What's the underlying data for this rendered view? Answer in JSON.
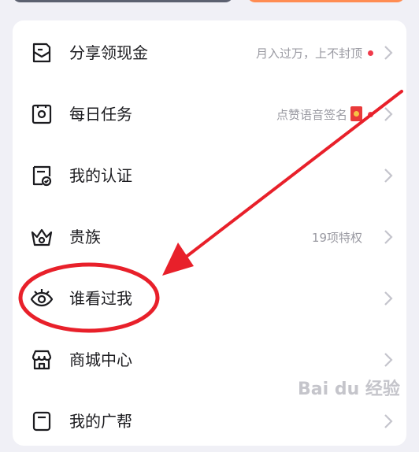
{
  "menu": {
    "items": [
      {
        "label": "分享领现金",
        "subtitle": "月入过万，上不封顶",
        "icon": "share-envelope-icon",
        "has_dot": true
      },
      {
        "label": "每日任务",
        "subtitle": "点赞语音签名",
        "icon": "daily-task-icon",
        "has_dot": true,
        "has_redpacket": true
      },
      {
        "label": "我的认证",
        "subtitle": "",
        "icon": "certification-icon"
      },
      {
        "label": "贵族",
        "subtitle": "19项特权",
        "icon": "crown-icon"
      },
      {
        "label": "谁看过我",
        "subtitle": "",
        "icon": "eye-icon"
      },
      {
        "label": "商城中心",
        "subtitle": "",
        "icon": "store-icon"
      },
      {
        "label": "我的广帮",
        "subtitle": "",
        "icon": "partial-icon"
      }
    ]
  },
  "watermark": "Bai du 经验",
  "colors": {
    "accent_red": "#f03a4a",
    "annotation_red": "#e8202a",
    "top_dark": "#5c6170",
    "top_orange": "#ff8c52"
  }
}
